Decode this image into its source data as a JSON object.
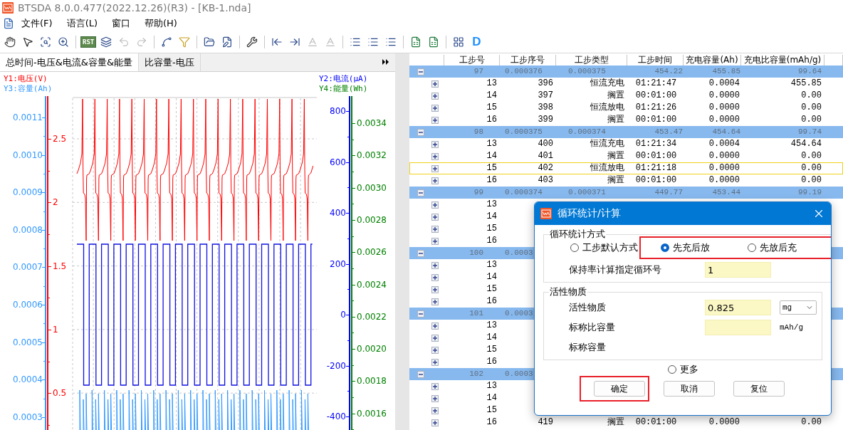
{
  "window": {
    "title": "BTSDA 8.0.0.477(2022.12.26)(R3) - [KB-1.nda]"
  },
  "menu": [
    "文件(F)",
    "语言(L)",
    "窗口",
    "帮助(H)"
  ],
  "toolbar": {
    "groups": [
      [
        {
          "kind": "hand",
          "disabled": false
        },
        {
          "kind": "pointer",
          "disabled": false
        },
        {
          "kind": "zoom-box",
          "disabled": false
        },
        {
          "kind": "zoom",
          "disabled": false
        }
      ],
      [
        {
          "kind": "rst",
          "label": "RST",
          "disabled": false
        },
        {
          "kind": "layers",
          "disabled": false
        },
        {
          "kind": "undo",
          "disabled": true
        },
        {
          "kind": "redo",
          "disabled": true
        }
      ],
      [
        {
          "kind": "curve",
          "disabled": false
        },
        {
          "kind": "filter",
          "disabled": false
        }
      ],
      [
        {
          "kind": "open",
          "disabled": false
        },
        {
          "kind": "edit-file",
          "disabled": false
        }
      ],
      [
        {
          "kind": "tool",
          "disabled": false
        }
      ],
      [
        {
          "kind": "first",
          "disabled": false
        },
        {
          "kind": "last",
          "disabled": false
        },
        {
          "kind": "baseline",
          "disabled": true
        },
        {
          "kind": "baseline",
          "disabled": true
        }
      ],
      [
        {
          "kind": "list",
          "disabled": false
        },
        {
          "kind": "list",
          "disabled": false
        },
        {
          "kind": "list",
          "disabled": false
        }
      ],
      [
        {
          "kind": "sheet",
          "disabled": false
        },
        {
          "kind": "sheet",
          "disabled": false
        }
      ],
      [
        {
          "kind": "grid",
          "disabled": false
        },
        {
          "kind": "letter",
          "label": "D",
          "disabled": false
        }
      ]
    ]
  },
  "tabs": [
    {
      "label": "总时间-电压&电流&容量&能量",
      "selected": true
    },
    {
      "label": "比容量-电压",
      "selected": false
    }
  ],
  "chart": {
    "legends": [
      {
        "text": "Y1:电压(V)",
        "color": "#ff0000"
      },
      {
        "text": "Y3:容量(Ah)",
        "color": "#3399ff"
      },
      {
        "text": "Y2:电流(μA)",
        "color": "#0000ff"
      },
      {
        "text": "Y4:能量(Wh)",
        "color": "#008000"
      }
    ],
    "axes": [
      {
        "color": "#3399ff",
        "ticks": [
          "0.0011",
          "0.0010",
          "0.0009",
          "0.0008",
          "0.0007",
          "0.0006",
          "0.0005",
          "0.0004",
          "0.0003"
        ]
      },
      {
        "color": "#ff0000",
        "ticks": [
          "2.5",
          "2",
          "1.5",
          "1",
          "0.5"
        ]
      },
      {
        "color": "#0000ff",
        "ticks": [
          "800",
          "600",
          "400",
          "200",
          "0",
          "-200",
          "-400"
        ]
      },
      {
        "color": "#008000",
        "ticks": [
          "0.0034",
          "0.0032",
          "0.0030",
          "0.0028",
          "0.0026",
          "0.0024",
          "0.0022",
          "0.0020",
          "0.0018",
          "0.0016"
        ]
      }
    ]
  },
  "table": {
    "columns": [
      "工步号",
      "工步序号",
      "工步类型",
      "工步时间",
      "充电容量(Ah)",
      "充电比容量(mAh/g)"
    ],
    "rows": [
      {
        "kind": "cycle",
        "expanded": true,
        "selected": false,
        "cells": [
          "97",
          "0.000376",
          "0.000375",
          "454.22",
          "455.85",
          "99.64"
        ]
      },
      {
        "kind": "step",
        "expanded": false,
        "selected": false,
        "cells": [
          "13",
          "396",
          "恒流充电",
          "01:21:47",
          "0.0004",
          "455.85"
        ]
      },
      {
        "kind": "step",
        "expanded": false,
        "selected": false,
        "cells": [
          "14",
          "397",
          "搁置",
          "00:01:00",
          "0.0000",
          "0.00"
        ]
      },
      {
        "kind": "step",
        "expanded": false,
        "selected": false,
        "cells": [
          "15",
          "398",
          "恒流放电",
          "01:21:26",
          "0.0000",
          "0.00"
        ]
      },
      {
        "kind": "step",
        "expanded": false,
        "selected": false,
        "cells": [
          "16",
          "399",
          "搁置",
          "00:01:00",
          "0.0000",
          "0.00"
        ]
      },
      {
        "kind": "cycle",
        "expanded": true,
        "selected": false,
        "cells": [
          "98",
          "0.000375",
          "0.000374",
          "453.47",
          "454.64",
          "99.74"
        ]
      },
      {
        "kind": "step",
        "expanded": false,
        "selected": false,
        "cells": [
          "13",
          "400",
          "恒流充电",
          "01:21:34",
          "0.0004",
          "454.64"
        ]
      },
      {
        "kind": "step",
        "expanded": false,
        "selected": false,
        "cells": [
          "14",
          "401",
          "搁置",
          "00:01:00",
          "0.0000",
          "0.00"
        ]
      },
      {
        "kind": "step",
        "expanded": false,
        "selected": true,
        "cells": [
          "15",
          "402",
          "恒流放电",
          "01:21:18",
          "0.0000",
          "0.00"
        ]
      },
      {
        "kind": "step",
        "expanded": false,
        "selected": false,
        "cells": [
          "16",
          "403",
          "搁置",
          "00:01:00",
          "0.0000",
          "0.00"
        ]
      },
      {
        "kind": "cycle",
        "expanded": true,
        "selected": false,
        "cells": [
          "99",
          "0.000374",
          "0.000371",
          "449.77",
          "453.44",
          "99.19"
        ]
      },
      {
        "kind": "step",
        "expanded": false,
        "selected": false,
        "cells": [
          "13"
        ]
      },
      {
        "kind": "step",
        "expanded": false,
        "selected": false,
        "cells": [
          "14"
        ]
      },
      {
        "kind": "step",
        "expanded": false,
        "selected": false,
        "cells": [
          "15"
        ]
      },
      {
        "kind": "step",
        "expanded": false,
        "selected": false,
        "cells": [
          "16"
        ]
      },
      {
        "kind": "cycle",
        "expanded": true,
        "selected": false,
        "cells": [
          "100",
          "0.0003"
        ]
      },
      {
        "kind": "step",
        "expanded": false,
        "selected": false,
        "cells": [
          "13"
        ]
      },
      {
        "kind": "step",
        "expanded": false,
        "selected": false,
        "cells": [
          "14"
        ]
      },
      {
        "kind": "step",
        "expanded": false,
        "selected": false,
        "cells": [
          "15"
        ]
      },
      {
        "kind": "step",
        "expanded": false,
        "selected": false,
        "cells": [
          "16"
        ]
      },
      {
        "kind": "cycle",
        "expanded": true,
        "selected": false,
        "cells": [
          "101",
          "0.0003"
        ]
      },
      {
        "kind": "step",
        "expanded": false,
        "selected": false,
        "cells": [
          "13"
        ]
      },
      {
        "kind": "step",
        "expanded": false,
        "selected": false,
        "cells": [
          "14"
        ]
      },
      {
        "kind": "step",
        "expanded": false,
        "selected": false,
        "cells": [
          "15"
        ]
      },
      {
        "kind": "step",
        "expanded": false,
        "selected": false,
        "cells": [
          "16"
        ]
      },
      {
        "kind": "cycle",
        "expanded": true,
        "selected": false,
        "cells": [
          "102",
          "0.0003"
        ]
      },
      {
        "kind": "step",
        "expanded": false,
        "selected": false,
        "cells": [
          "13"
        ]
      },
      {
        "kind": "step",
        "expanded": false,
        "selected": false,
        "cells": [
          "14"
        ]
      },
      {
        "kind": "step",
        "expanded": false,
        "selected": false,
        "cells": [
          "15"
        ]
      },
      {
        "kind": "step",
        "expanded": false,
        "selected": false,
        "cells": [
          "16",
          "419",
          "搁置",
          "00:01:00",
          "0.0000",
          "0.00"
        ]
      }
    ]
  },
  "dialog": {
    "title": "循环统计/计算",
    "mode_group": {
      "title": "循环统计方式",
      "options": [
        {
          "label": "工步默认方式",
          "selected": false,
          "highlighted": false
        },
        {
          "label": "先充后放",
          "selected": true,
          "highlighted": true
        },
        {
          "label": "先放后充",
          "selected": false,
          "highlighted": true
        }
      ],
      "fields": [
        {
          "kind": "input",
          "label": "保持率计算指定循环号",
          "value": "1"
        }
      ]
    },
    "material_group": {
      "title": "活性物质",
      "fields": [
        {
          "kind": "input-select",
          "label": "活性物质",
          "value": "0.825",
          "unit": "mg"
        },
        {
          "kind": "input-unit",
          "label": "标称比容量",
          "unit": "mAh/g"
        },
        {
          "kind": "text",
          "label": "标称容量"
        }
      ]
    },
    "more": {
      "label": "更多",
      "selected": false
    },
    "buttons": [
      {
        "label": "确定",
        "highlighted": true
      },
      {
        "label": "取消",
        "highlighted": false
      },
      {
        "label": "复位",
        "highlighted": false
      }
    ]
  }
}
